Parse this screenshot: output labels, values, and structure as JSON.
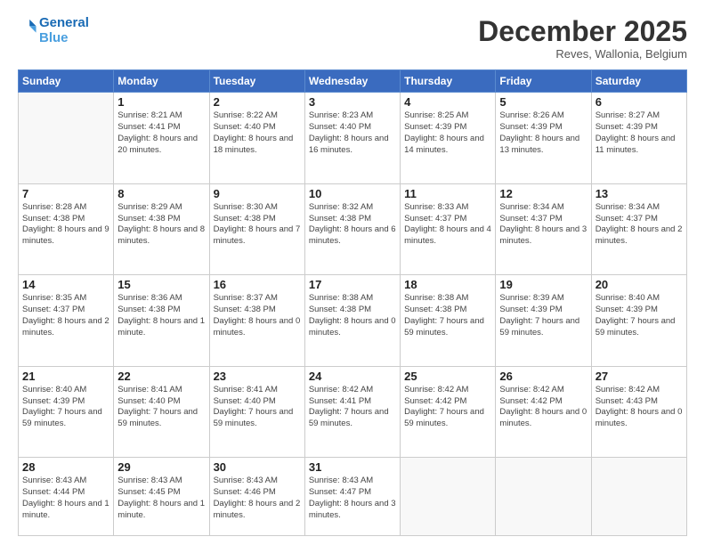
{
  "header": {
    "logo_line1": "General",
    "logo_line2": "Blue",
    "month": "December 2025",
    "location": "Reves, Wallonia, Belgium"
  },
  "weekdays": [
    "Sunday",
    "Monday",
    "Tuesday",
    "Wednesday",
    "Thursday",
    "Friday",
    "Saturday"
  ],
  "weeks": [
    [
      {
        "day": "",
        "sunrise": "",
        "sunset": "",
        "daylight": ""
      },
      {
        "day": "1",
        "sunrise": "Sunrise: 8:21 AM",
        "sunset": "Sunset: 4:41 PM",
        "daylight": "Daylight: 8 hours and 20 minutes."
      },
      {
        "day": "2",
        "sunrise": "Sunrise: 8:22 AM",
        "sunset": "Sunset: 4:40 PM",
        "daylight": "Daylight: 8 hours and 18 minutes."
      },
      {
        "day": "3",
        "sunrise": "Sunrise: 8:23 AM",
        "sunset": "Sunset: 4:40 PM",
        "daylight": "Daylight: 8 hours and 16 minutes."
      },
      {
        "day": "4",
        "sunrise": "Sunrise: 8:25 AM",
        "sunset": "Sunset: 4:39 PM",
        "daylight": "Daylight: 8 hours and 14 minutes."
      },
      {
        "day": "5",
        "sunrise": "Sunrise: 8:26 AM",
        "sunset": "Sunset: 4:39 PM",
        "daylight": "Daylight: 8 hours and 13 minutes."
      },
      {
        "day": "6",
        "sunrise": "Sunrise: 8:27 AM",
        "sunset": "Sunset: 4:39 PM",
        "daylight": "Daylight: 8 hours and 11 minutes."
      }
    ],
    [
      {
        "day": "7",
        "sunrise": "Sunrise: 8:28 AM",
        "sunset": "Sunset: 4:38 PM",
        "daylight": "Daylight: 8 hours and 9 minutes."
      },
      {
        "day": "8",
        "sunrise": "Sunrise: 8:29 AM",
        "sunset": "Sunset: 4:38 PM",
        "daylight": "Daylight: 8 hours and 8 minutes."
      },
      {
        "day": "9",
        "sunrise": "Sunrise: 8:30 AM",
        "sunset": "Sunset: 4:38 PM",
        "daylight": "Daylight: 8 hours and 7 minutes."
      },
      {
        "day": "10",
        "sunrise": "Sunrise: 8:32 AM",
        "sunset": "Sunset: 4:38 PM",
        "daylight": "Daylight: 8 hours and 6 minutes."
      },
      {
        "day": "11",
        "sunrise": "Sunrise: 8:33 AM",
        "sunset": "Sunset: 4:37 PM",
        "daylight": "Daylight: 8 hours and 4 minutes."
      },
      {
        "day": "12",
        "sunrise": "Sunrise: 8:34 AM",
        "sunset": "Sunset: 4:37 PM",
        "daylight": "Daylight: 8 hours and 3 minutes."
      },
      {
        "day": "13",
        "sunrise": "Sunrise: 8:34 AM",
        "sunset": "Sunset: 4:37 PM",
        "daylight": "Daylight: 8 hours and 2 minutes."
      }
    ],
    [
      {
        "day": "14",
        "sunrise": "Sunrise: 8:35 AM",
        "sunset": "Sunset: 4:37 PM",
        "daylight": "Daylight: 8 hours and 2 minutes."
      },
      {
        "day": "15",
        "sunrise": "Sunrise: 8:36 AM",
        "sunset": "Sunset: 4:38 PM",
        "daylight": "Daylight: 8 hours and 1 minute."
      },
      {
        "day": "16",
        "sunrise": "Sunrise: 8:37 AM",
        "sunset": "Sunset: 4:38 PM",
        "daylight": "Daylight: 8 hours and 0 minutes."
      },
      {
        "day": "17",
        "sunrise": "Sunrise: 8:38 AM",
        "sunset": "Sunset: 4:38 PM",
        "daylight": "Daylight: 8 hours and 0 minutes."
      },
      {
        "day": "18",
        "sunrise": "Sunrise: 8:38 AM",
        "sunset": "Sunset: 4:38 PM",
        "daylight": "Daylight: 7 hours and 59 minutes."
      },
      {
        "day": "19",
        "sunrise": "Sunrise: 8:39 AM",
        "sunset": "Sunset: 4:39 PM",
        "daylight": "Daylight: 7 hours and 59 minutes."
      },
      {
        "day": "20",
        "sunrise": "Sunrise: 8:40 AM",
        "sunset": "Sunset: 4:39 PM",
        "daylight": "Daylight: 7 hours and 59 minutes."
      }
    ],
    [
      {
        "day": "21",
        "sunrise": "Sunrise: 8:40 AM",
        "sunset": "Sunset: 4:39 PM",
        "daylight": "Daylight: 7 hours and 59 minutes."
      },
      {
        "day": "22",
        "sunrise": "Sunrise: 8:41 AM",
        "sunset": "Sunset: 4:40 PM",
        "daylight": "Daylight: 7 hours and 59 minutes."
      },
      {
        "day": "23",
        "sunrise": "Sunrise: 8:41 AM",
        "sunset": "Sunset: 4:40 PM",
        "daylight": "Daylight: 7 hours and 59 minutes."
      },
      {
        "day": "24",
        "sunrise": "Sunrise: 8:42 AM",
        "sunset": "Sunset: 4:41 PM",
        "daylight": "Daylight: 7 hours and 59 minutes."
      },
      {
        "day": "25",
        "sunrise": "Sunrise: 8:42 AM",
        "sunset": "Sunset: 4:42 PM",
        "daylight": "Daylight: 7 hours and 59 minutes."
      },
      {
        "day": "26",
        "sunrise": "Sunrise: 8:42 AM",
        "sunset": "Sunset: 4:42 PM",
        "daylight": "Daylight: 8 hours and 0 minutes."
      },
      {
        "day": "27",
        "sunrise": "Sunrise: 8:42 AM",
        "sunset": "Sunset: 4:43 PM",
        "daylight": "Daylight: 8 hours and 0 minutes."
      }
    ],
    [
      {
        "day": "28",
        "sunrise": "Sunrise: 8:43 AM",
        "sunset": "Sunset: 4:44 PM",
        "daylight": "Daylight: 8 hours and 1 minute."
      },
      {
        "day": "29",
        "sunrise": "Sunrise: 8:43 AM",
        "sunset": "Sunset: 4:45 PM",
        "daylight": "Daylight: 8 hours and 1 minute."
      },
      {
        "day": "30",
        "sunrise": "Sunrise: 8:43 AM",
        "sunset": "Sunset: 4:46 PM",
        "daylight": "Daylight: 8 hours and 2 minutes."
      },
      {
        "day": "31",
        "sunrise": "Sunrise: 8:43 AM",
        "sunset": "Sunset: 4:47 PM",
        "daylight": "Daylight: 8 hours and 3 minutes."
      },
      {
        "day": "",
        "sunrise": "",
        "sunset": "",
        "daylight": ""
      },
      {
        "day": "",
        "sunrise": "",
        "sunset": "",
        "daylight": ""
      },
      {
        "day": "",
        "sunrise": "",
        "sunset": "",
        "daylight": ""
      }
    ]
  ]
}
